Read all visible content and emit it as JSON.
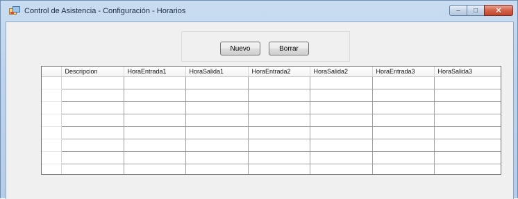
{
  "window": {
    "title": "Control de Asistencia - Configuración - Horarios",
    "minimize_glyph": "–",
    "maximize_glyph": "□",
    "close_glyph": "✕",
    "icon": "app-window-icon"
  },
  "toolbar": {
    "nuevo_label": "Nuevo",
    "borrar_label": "Borrar"
  },
  "grid": {
    "columns": [
      "Descripcion",
      "HoraEntrada1",
      "HoraSalida1",
      "HoraEntrada2",
      "HoraSalida2",
      "HoraEntrada3",
      "HoraSalida3"
    ],
    "row_count": 8
  },
  "colors": {
    "title_bar": "#bcd3ee",
    "client_bg": "#f0f0f0",
    "close_button": "#c0452d"
  }
}
